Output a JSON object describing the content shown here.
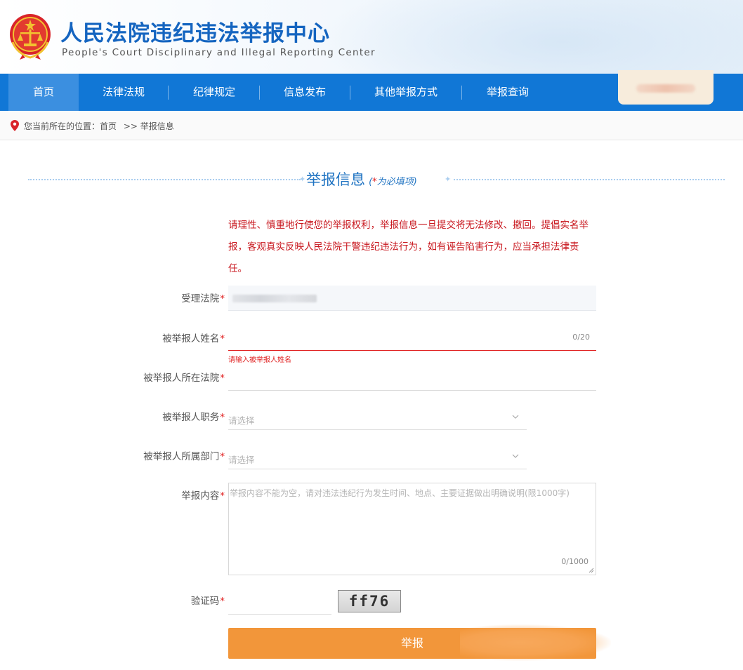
{
  "header": {
    "title": "人民法院违纪违法举报中心",
    "subtitle": "People's Court Disciplinary and Illegal Reporting Center"
  },
  "nav": {
    "items": [
      {
        "label": "首页",
        "active": true
      },
      {
        "label": "法律法规"
      },
      {
        "label": "纪律规定"
      },
      {
        "label": "信息发布"
      },
      {
        "label": "其他举报方式"
      },
      {
        "label": "举报查询"
      }
    ]
  },
  "breadcrumb": {
    "prefix": "您当前所在的位置：",
    "home": "首页",
    "separator": ">>",
    "current": "举报信息"
  },
  "section": {
    "title": "举报信息",
    "note_open": "(",
    "note_star": "*",
    "note_text": "为必填项",
    "note_close": ")"
  },
  "notice": "请理性、慎重地行使您的举报权利，举报信息一旦提交将无法修改、撤回。提倡实名举报，客观真实反映人民法院干警违纪违法行为，如有诬告陷害行为，应当承担法律责任。",
  "form": {
    "required_mark": "*",
    "court": {
      "label": "受理法院"
    },
    "name": {
      "label": "被举报人姓名",
      "counter": "0/20",
      "error": "请输入被举报人姓名"
    },
    "person_court": {
      "label": "被举报人所在法院"
    },
    "position": {
      "label": "被举报人职务",
      "placeholder": "请选择"
    },
    "department": {
      "label": "被举报人所属部门",
      "placeholder": "请选择"
    },
    "content": {
      "label": "举报内容",
      "placeholder": "举报内容不能为空，请对违法违纪行为发生时间、地点、主要证据做出明确说明(限1000字)",
      "counter": "0/1000"
    },
    "captcha": {
      "label": "验证码",
      "code": "ff76"
    },
    "submit_label": "举报"
  },
  "colors": {
    "brand_blue": "#1177d6",
    "title_blue": "#1565c0",
    "notice_red": "#c8161d",
    "submit_orange": "#f2963a"
  }
}
